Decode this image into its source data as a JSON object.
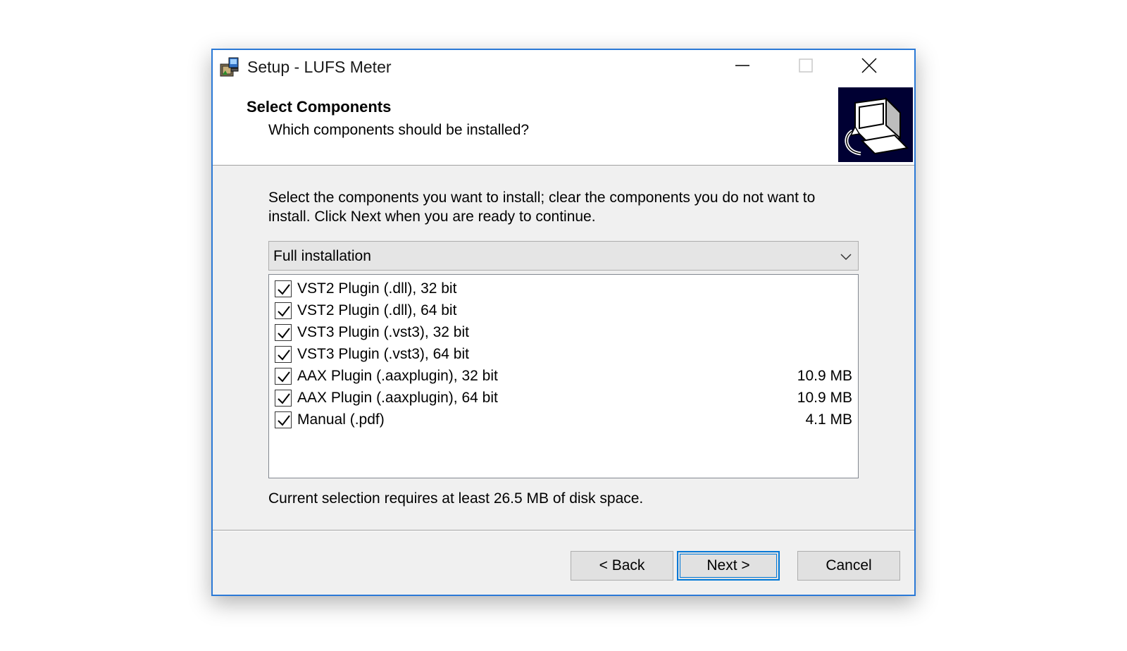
{
  "window": {
    "title": "Setup - LUFS Meter",
    "icons": {
      "app": "setup-package-icon",
      "minimize": "minimize-icon",
      "maximize": "maximize-icon",
      "close": "close-icon"
    }
  },
  "header": {
    "title": "Select Components",
    "subtitle": "Which components should be installed?",
    "image_icon": "computer-install-icon"
  },
  "body": {
    "instructions": "Select the components you want to install; clear the components you do not want to install. Click Next when you are ready to continue.",
    "install_type": {
      "selected": "Full installation",
      "arrow_icon": "chevron-down-icon"
    },
    "components": [
      {
        "label": "VST2 Plugin (.dll), 32 bit",
        "size": "",
        "checked": true
      },
      {
        "label": "VST2 Plugin (.dll), 64 bit",
        "size": "",
        "checked": true
      },
      {
        "label": "VST3 Plugin (.vst3), 32 bit",
        "size": "",
        "checked": true
      },
      {
        "label": "VST3 Plugin (.vst3), 64 bit",
        "size": "",
        "checked": true
      },
      {
        "label": "AAX Plugin (.aaxplugin), 32 bit",
        "size": "10.9 MB",
        "checked": true
      },
      {
        "label": "AAX Plugin (.aaxplugin), 64 bit",
        "size": "10.9 MB",
        "checked": true
      },
      {
        "label": "Manual (.pdf)",
        "size": "4.1 MB",
        "checked": true
      }
    ],
    "disk_space": "Current selection requires at least 26.5 MB of disk space."
  },
  "footer": {
    "back_label": "< Back",
    "next_label": "Next >",
    "cancel_label": "Cancel"
  },
  "colors": {
    "window_border": "#2b79d6",
    "focus_accent": "#0078d7",
    "dialog_background": "#f0f0f0",
    "wizard_image_background": "#000033"
  }
}
